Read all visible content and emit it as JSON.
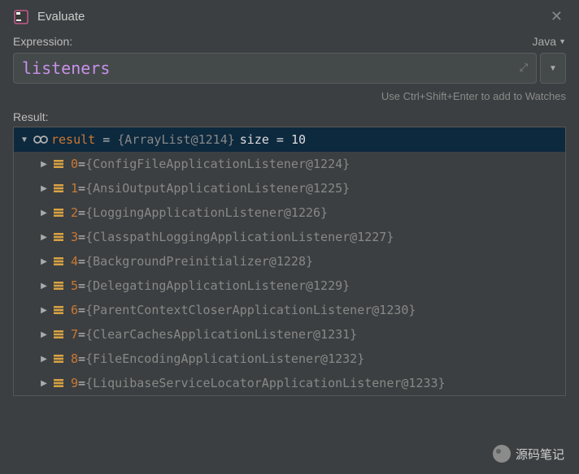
{
  "window": {
    "title": "Evaluate"
  },
  "expression": {
    "label": "Expression:",
    "language": "Java",
    "value": "listeners",
    "hint": "Use Ctrl+Shift+Enter to add to Watches"
  },
  "result": {
    "label": "Result:",
    "root": {
      "name": "result",
      "type": "{ArrayList@1214}",
      "size_label": "size = 10"
    },
    "items": [
      {
        "index": "0",
        "value": "{ConfigFileApplicationListener@1224}"
      },
      {
        "index": "1",
        "value": "{AnsiOutputApplicationListener@1225}"
      },
      {
        "index": "2",
        "value": "{LoggingApplicationListener@1226}"
      },
      {
        "index": "3",
        "value": "{ClasspathLoggingApplicationListener@1227}"
      },
      {
        "index": "4",
        "value": "{BackgroundPreinitializer@1228}"
      },
      {
        "index": "5",
        "value": "{DelegatingApplicationListener@1229}"
      },
      {
        "index": "6",
        "value": "{ParentContextCloserApplicationListener@1230}"
      },
      {
        "index": "7",
        "value": "{ClearCachesApplicationListener@1231}"
      },
      {
        "index": "8",
        "value": "{FileEncodingApplicationListener@1232}"
      },
      {
        "index": "9",
        "value": "{LiquibaseServiceLocatorApplicationListener@1233}"
      }
    ]
  },
  "watermark": "源码笔记"
}
